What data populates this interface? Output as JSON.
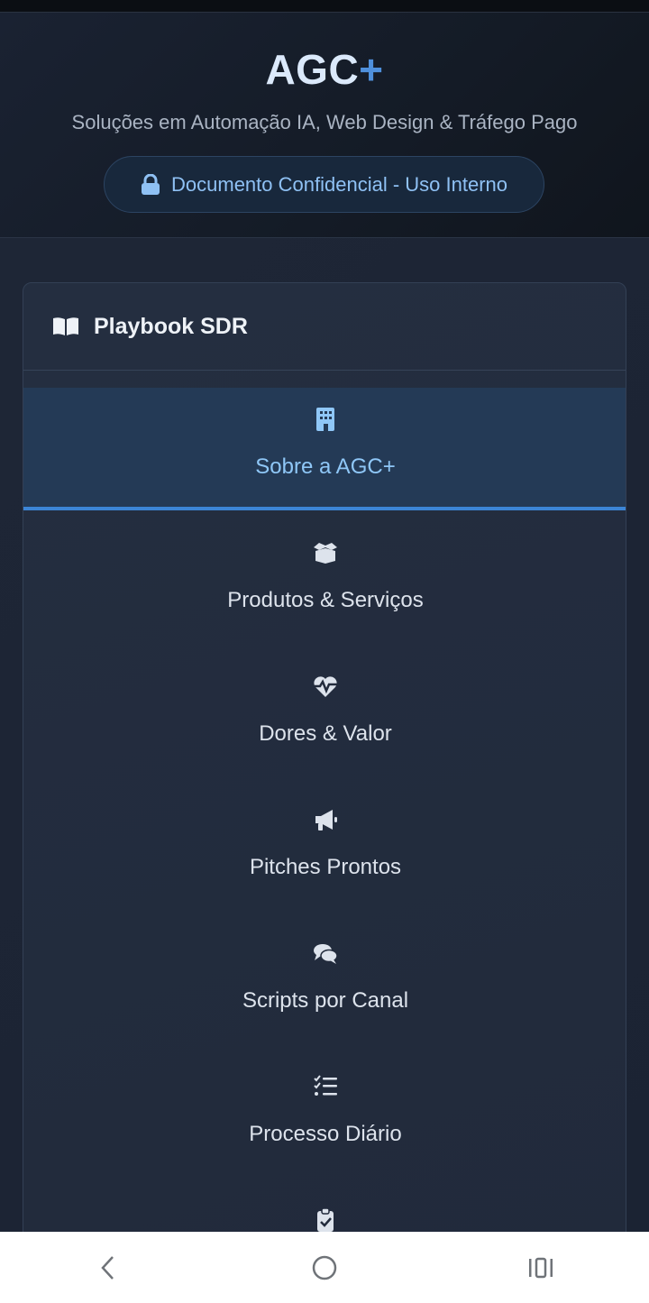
{
  "header": {
    "brand_main": "AGC",
    "brand_plus": "+",
    "subtitle": "Soluções em Automação IA, Web Design & Tráfego Pago",
    "confidential_label": "Documento Confidencial - Uso Interno"
  },
  "card": {
    "title": "Playbook SDR",
    "icon": "book-icon"
  },
  "nav": {
    "items": [
      {
        "label": "Sobre a AGC+",
        "icon": "building-icon",
        "active": true
      },
      {
        "label": "Produtos & Serviços",
        "icon": "box-icon",
        "active": false
      },
      {
        "label": "Dores & Valor",
        "icon": "heart-pulse-icon",
        "active": false
      },
      {
        "label": "Pitches Prontos",
        "icon": "megaphone-icon",
        "active": false
      },
      {
        "label": "Scripts por Canal",
        "icon": "comments-icon",
        "active": false
      },
      {
        "label": "Processo Diário",
        "icon": "checklist-icon",
        "active": false
      },
      {
        "label": "",
        "icon": "clipboard-check-icon",
        "active": false
      }
    ]
  },
  "colors": {
    "accent": "#3c85d6",
    "active_text": "#8fc7f7",
    "background": "#1c2433"
  }
}
